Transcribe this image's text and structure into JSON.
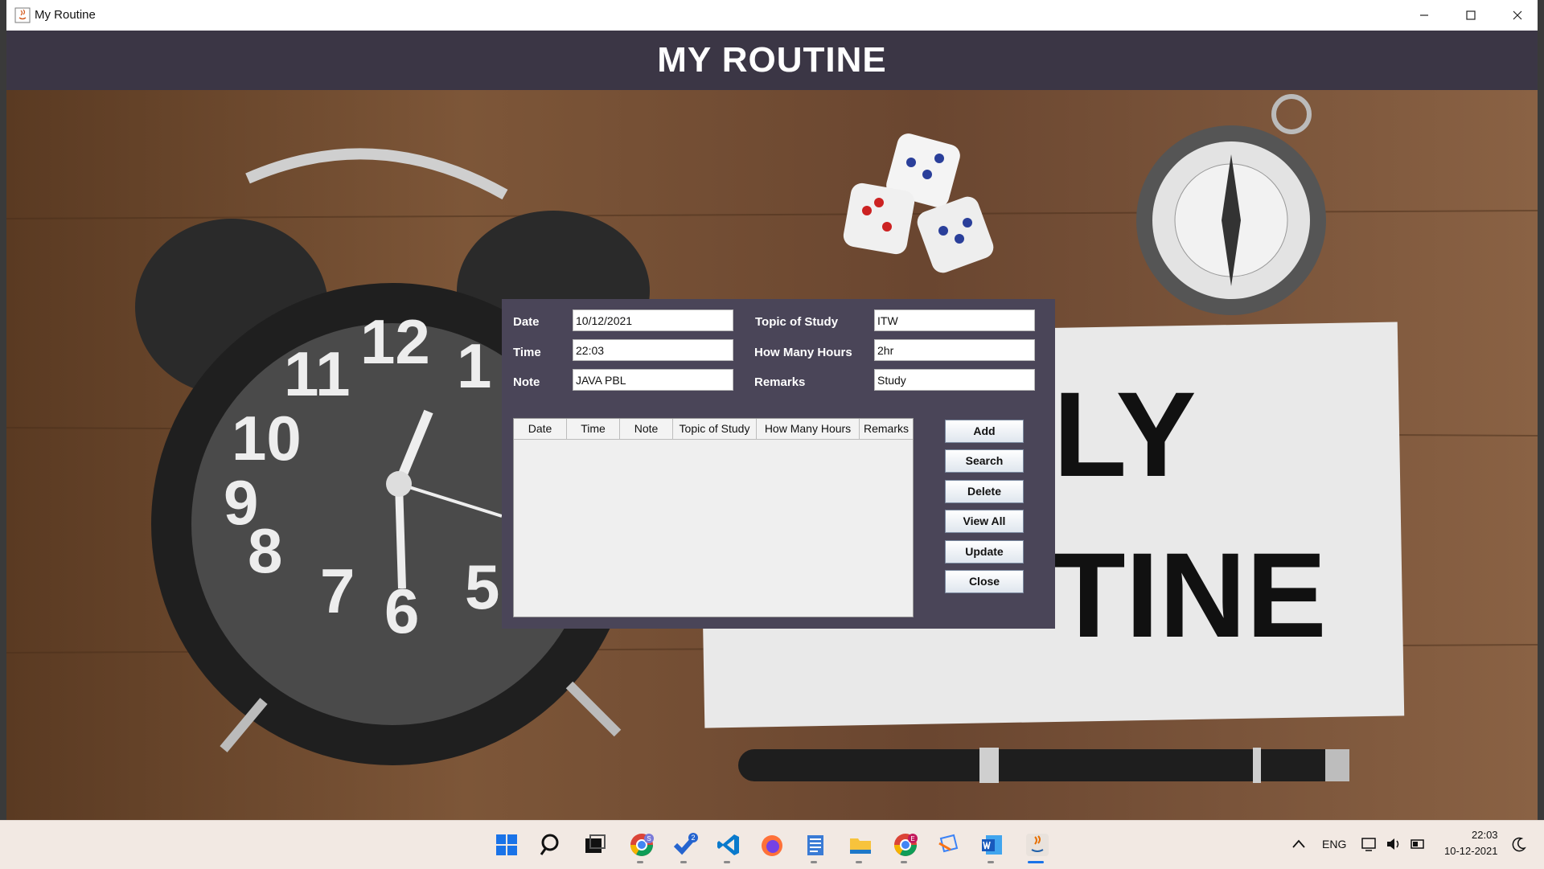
{
  "window": {
    "title": "My Routine",
    "controls": [
      "minimize-icon",
      "maximize-icon",
      "close-icon"
    ]
  },
  "header": {
    "title": "MY ROUTINE"
  },
  "background": {
    "poster_text_line1": "ILY",
    "poster_text_line2": "TINE",
    "clock_numbers": [
      "12",
      "1",
      "11",
      "10",
      "9",
      "8",
      "7",
      "6",
      "5"
    ]
  },
  "form": {
    "date": {
      "label": "Date",
      "value": "10/12/2021"
    },
    "time": {
      "label": "Time",
      "value": "22:03"
    },
    "note": {
      "label": "Note",
      "value": "JAVA PBL"
    },
    "topic": {
      "label": "Topic of Study",
      "value": "ITW"
    },
    "hours": {
      "label": "How Many Hours",
      "value": "2hr"
    },
    "remarks": {
      "label": "Remarks",
      "value": "Study"
    }
  },
  "table": {
    "columns": [
      "Date",
      "Time",
      "Note",
      "Topic of Study",
      "How Many Hours",
      "Remarks"
    ],
    "rows": []
  },
  "buttons": {
    "add": "Add",
    "search": "Search",
    "delete": "Delete",
    "view_all": "View All",
    "update": "Update",
    "close": "Close"
  },
  "taskbar": {
    "icons": [
      "windows-start-icon",
      "search-icon",
      "task-view-icon",
      "chrome-icon",
      "todo-icon",
      "vscode-icon",
      "firefox-icon",
      "notepad-icon",
      "file-explorer-icon",
      "chrome-profile-icon",
      "media-player-icon",
      "word-icon",
      "java-icon"
    ],
    "todo_badge": "2",
    "chrome_badge": "S",
    "chrome_profile_badge": "E",
    "language": "ENG",
    "time": "22:03",
    "date": "10-12-2021"
  }
}
